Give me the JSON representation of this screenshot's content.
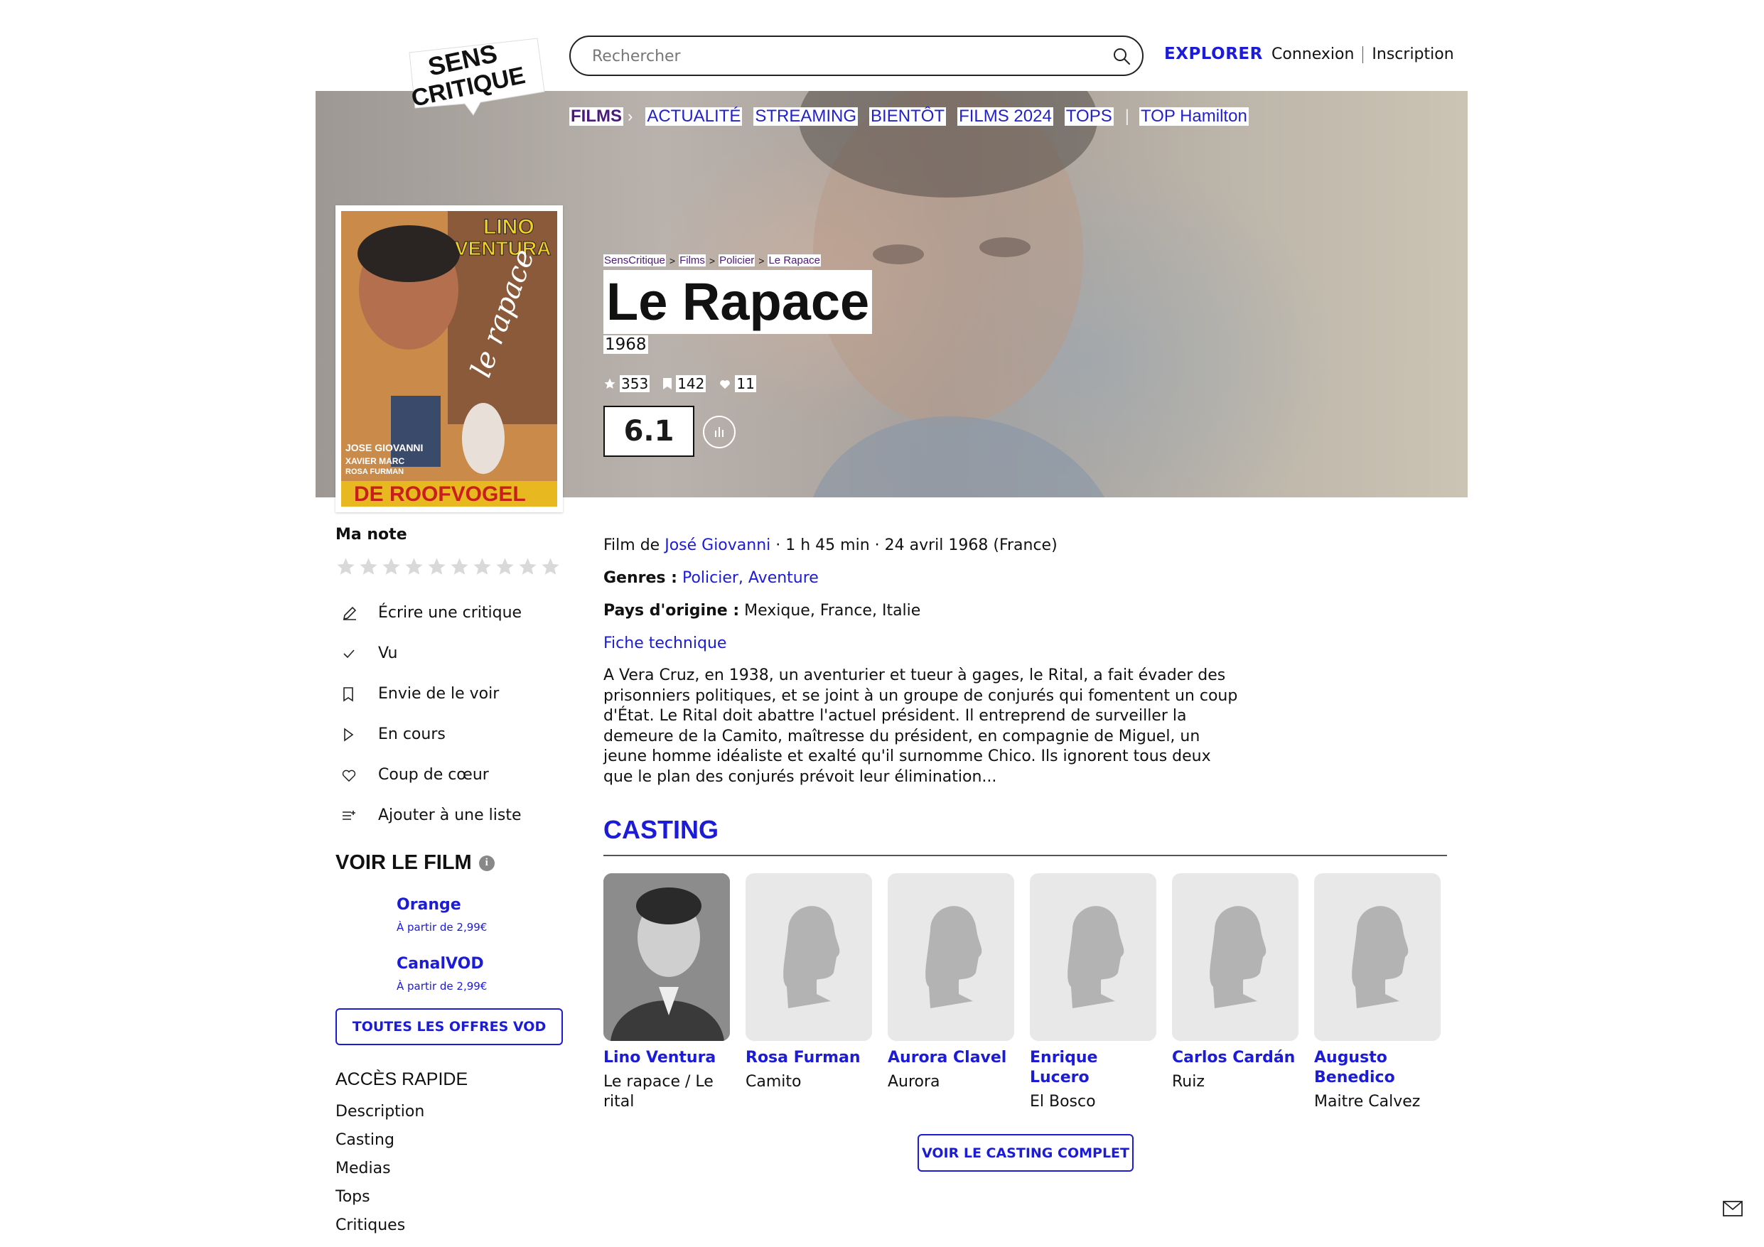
{
  "header": {
    "logo_text": [
      "SENS",
      "CRITIQUE"
    ],
    "search_placeholder": "Rechercher",
    "explorer": "EXPLORER",
    "login": "Connexion",
    "signup": "Inscription"
  },
  "nav": {
    "active": "FILMS",
    "items": [
      "ACTUALITÉ",
      "STREAMING",
      "BIENTÔT",
      "FILMS 2024",
      "TOPS"
    ],
    "extra": "TOP Hamilton"
  },
  "poster": {
    "top_text_1": "LINO",
    "top_text_2": "VENTURA",
    "script_title": "le rapace",
    "credits_1": "JOSE GIOVANNI",
    "credits_2": "XAVIER MARC",
    "credits_3": "ROSA FURMAN",
    "bottom_text": "DE ROOFVOGEL"
  },
  "breadcrumb": [
    "SensCritique",
    "Films",
    "Policier",
    "Le Rapace"
  ],
  "film": {
    "title": "Le Rapace",
    "year": "1968",
    "ratings_count": "353",
    "wishes_count": "142",
    "favorites_count": "11",
    "score": "6.1",
    "meta_prefix": "Film de ",
    "director": "José Giovanni",
    "meta_suffix": " · 1 h 45 min · 24 avril 1968 (France)",
    "genres_label": "Genres :",
    "genres": "Policier, Aventure",
    "countries_label": "Pays d'origine :",
    "countries": "Mexique, France, Italie",
    "tech_sheet": "Fiche technique",
    "synopsis": "A Vera Cruz, en 1938, un aventurier et tueur à gages, le Rital, a fait évader des prisonniers politiques, et se joint à un groupe de conjurés qui fomentent un coup d'État. Le Rital doit abattre l'actuel président. Il entreprend de surveiller la demeure de la Camito, maîtresse du président, en compagnie de Miguel, un jeune homme idéaliste et exalté qu'il surnomme Chico. Ils ignorent tous deux que le plan des conjurés prévoit leur élimination..."
  },
  "sidebar": {
    "my_rating": "Ma note",
    "actions": [
      {
        "label": "Écrire une critique",
        "icon": "pencil-icon"
      },
      {
        "label": "Vu",
        "icon": "check-icon"
      },
      {
        "label": "Envie de le voir",
        "icon": "bookmark-icon"
      },
      {
        "label": "En cours",
        "icon": "play-icon"
      },
      {
        "label": "Coup de cœur",
        "icon": "heart-icon"
      },
      {
        "label": "Ajouter à une liste",
        "icon": "add-list-icon"
      }
    ],
    "watch_title": "VOIR LE FILM",
    "providers": [
      {
        "name": "Orange",
        "price": "À partir de 2,99€"
      },
      {
        "name": "CanalVOD",
        "price": "À partir de 2,99€"
      }
    ],
    "vod_button": "TOUTES LES OFFRES VOD",
    "quick_title": "ACCÈS RAPIDE",
    "quick_links": [
      "Description",
      "Casting",
      "Medias",
      "Tops",
      "Critiques"
    ]
  },
  "casting": {
    "title": "CASTING",
    "members": [
      {
        "name": "Lino Ventura",
        "role": "Le rapace / Le rital",
        "has_photo": true
      },
      {
        "name": "Rosa Furman",
        "role": "Camito",
        "has_photo": false
      },
      {
        "name": "Aurora Clavel",
        "role": "Aurora",
        "has_photo": false
      },
      {
        "name": "Enrique Lucero",
        "role": "El Bosco",
        "has_photo": false
      },
      {
        "name": "Carlos Cardán",
        "role": "Ruiz",
        "has_photo": false
      },
      {
        "name": "Augusto Benedico",
        "role": "Maitre Calvez",
        "has_photo": false
      }
    ],
    "button": "VOIR LE CASTING COMPLET"
  },
  "colors": {
    "accent": "#1b1bd8",
    "nav_active": "#4a1a7a",
    "placeholder_bg": "#e8e8e8",
    "star_empty": "#d9d9d9"
  }
}
